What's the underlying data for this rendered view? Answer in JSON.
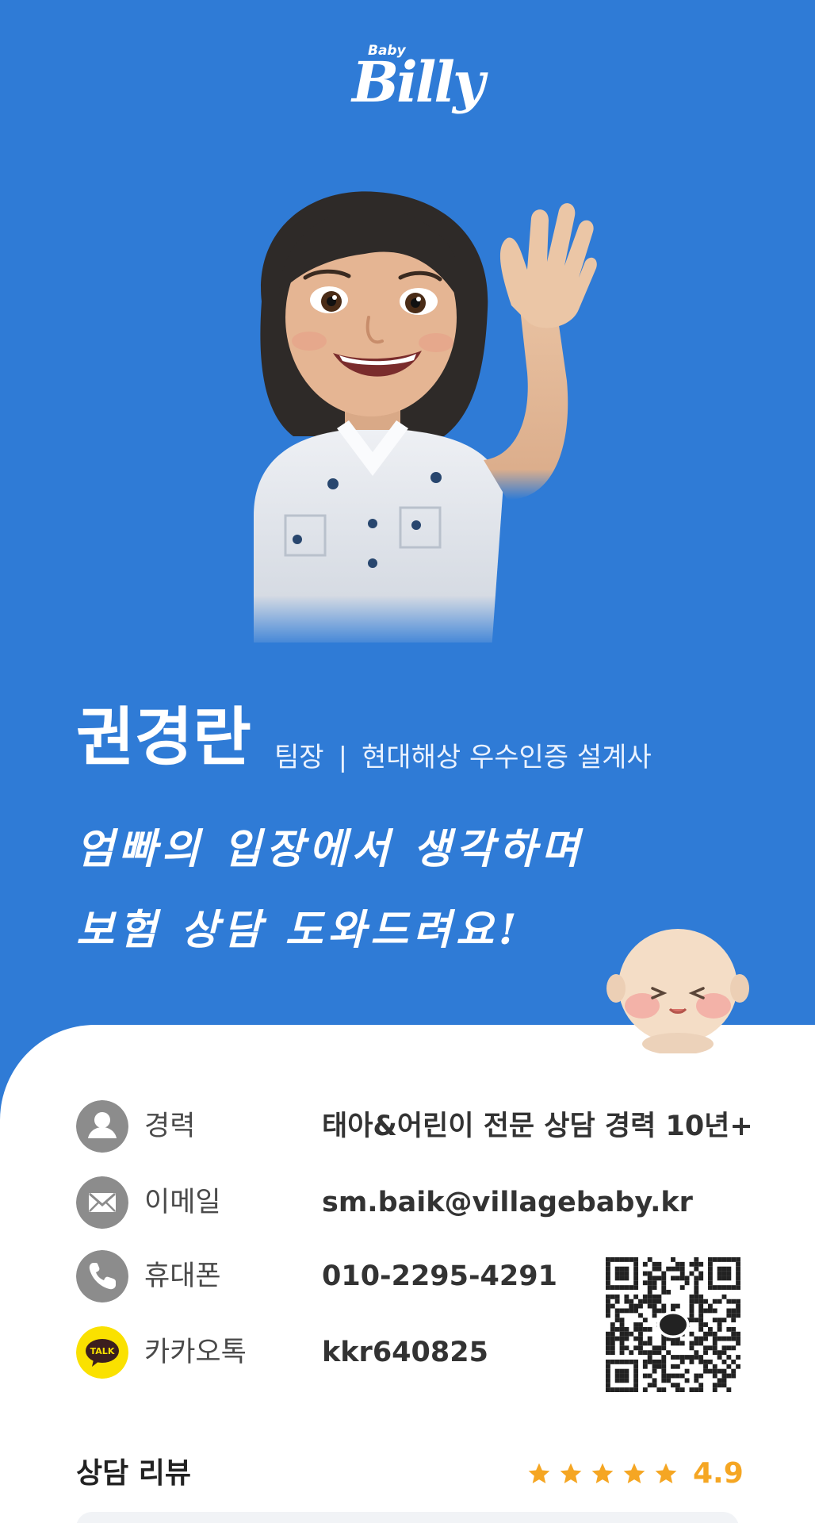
{
  "brand": {
    "logo_small": "Baby",
    "logo_main": "Billy"
  },
  "profile": {
    "name": "권경란",
    "position": "팀장",
    "separator": "|",
    "affiliation": "현대해상 우수인증 설계사",
    "slogan_line1": "엄빠의 입장에서 생각하며",
    "slogan_line2": "보험 상담 도와드려요!"
  },
  "contact": {
    "items": [
      {
        "label": "경력",
        "value": "태아&어린이 전문 상담 경력 10년+",
        "icon": "person-icon"
      },
      {
        "label": "이메일",
        "value": "sm.baik@villagebaby.kr",
        "icon": "mail-icon"
      },
      {
        "label": "휴대폰",
        "value": "010-2295-4291",
        "icon": "phone-icon"
      },
      {
        "label": "카카오톡",
        "value": "kkr640825",
        "icon": "kakaotalk-icon",
        "icon_text": "TALK"
      }
    ]
  },
  "reviews": {
    "title": "상담 리뷰",
    "rating": "4.9",
    "stars": 5
  },
  "colors": {
    "hero_bg": "#2f7bd6",
    "icon_gray": "#8c8c8c",
    "kakao_yellow": "#fae100",
    "star": "#f5a623"
  }
}
